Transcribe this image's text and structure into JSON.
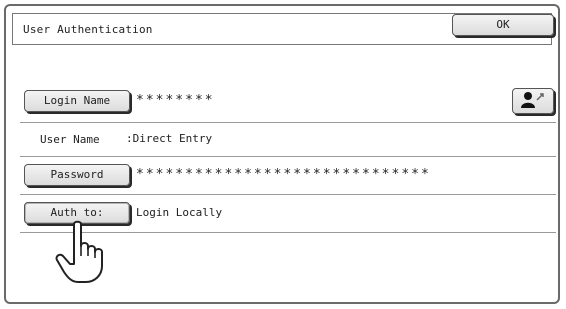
{
  "header": {
    "title": "User Authentication",
    "ok_label": "OK"
  },
  "login": {
    "button_label": "Login Name",
    "value": "********"
  },
  "user": {
    "label": "User Name",
    "value": ":Direct Entry"
  },
  "password": {
    "button_label": "Password",
    "value": "******************************"
  },
  "auth": {
    "button_label": "Auth to:",
    "value": "Login Locally"
  },
  "icons": {
    "switch_user": "user-switch-icon",
    "pointer": "pointing-hand-icon"
  }
}
